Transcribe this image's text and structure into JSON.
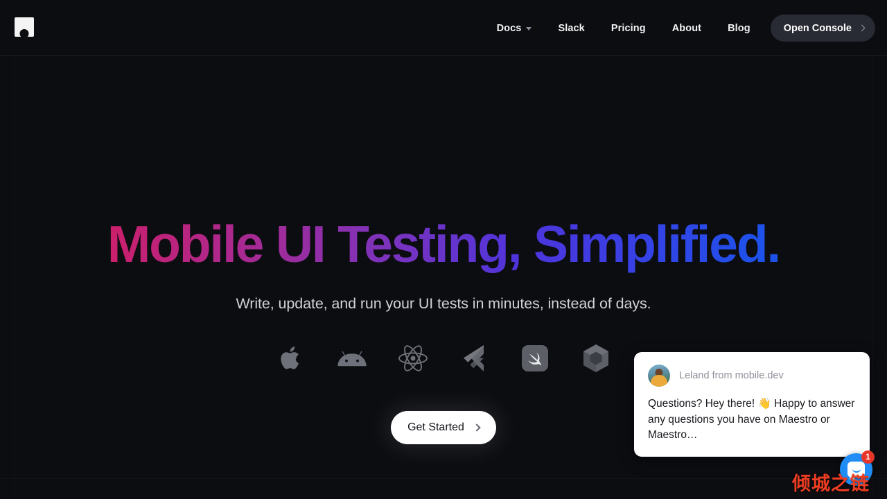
{
  "colors": {
    "page_bg": "#0c0d11",
    "headline_gradient_start": "#e4175c",
    "headline_gradient_mid": "#7a33bd",
    "headline_gradient_end": "#1456ec",
    "console_button_bg": "#282b33",
    "cta_bg": "#ffffff",
    "launcher_bg": "#1f8df5",
    "badge_bg": "#e8352a",
    "watermark": "#ef3d22"
  },
  "header": {
    "logo_name": "maestro-logo",
    "nav": [
      {
        "label": "Docs",
        "has_caret": true,
        "icon": "chevron-down-icon"
      },
      {
        "label": "Slack",
        "has_caret": false
      },
      {
        "label": "Pricing",
        "has_caret": false
      },
      {
        "label": "About",
        "has_caret": false
      },
      {
        "label": "Blog",
        "has_caret": false
      }
    ],
    "console_button": {
      "label": "Open Console",
      "icon": "chevron-right-icon"
    }
  },
  "hero": {
    "headline": "Mobile UI Testing, Simplified.",
    "subheadline": "Write, update, and run your UI tests in minutes, instead of days.",
    "platforms": [
      {
        "name": "apple-icon",
        "label": "Apple"
      },
      {
        "name": "android-icon",
        "label": "Android"
      },
      {
        "name": "react-native-icon",
        "label": "React Native"
      },
      {
        "name": "flutter-icon",
        "label": "Flutter"
      },
      {
        "name": "swift-icon",
        "label": "Swift"
      },
      {
        "name": "jetpack-compose-icon",
        "label": "Jetpack Compose"
      }
    ],
    "cta": {
      "label": "Get Started",
      "icon": "chevron-right-icon"
    }
  },
  "chat": {
    "sender": "Leland from mobile.dev",
    "message": "Questions? Hey there! 👋 Happy to answer any questions you have on Maestro or Maestro…",
    "avatar_name": "leland-avatar",
    "launcher": {
      "icon": "chat-bubble-icon",
      "badge_count": "1"
    }
  },
  "watermark": {
    "text": "倾城之链"
  }
}
